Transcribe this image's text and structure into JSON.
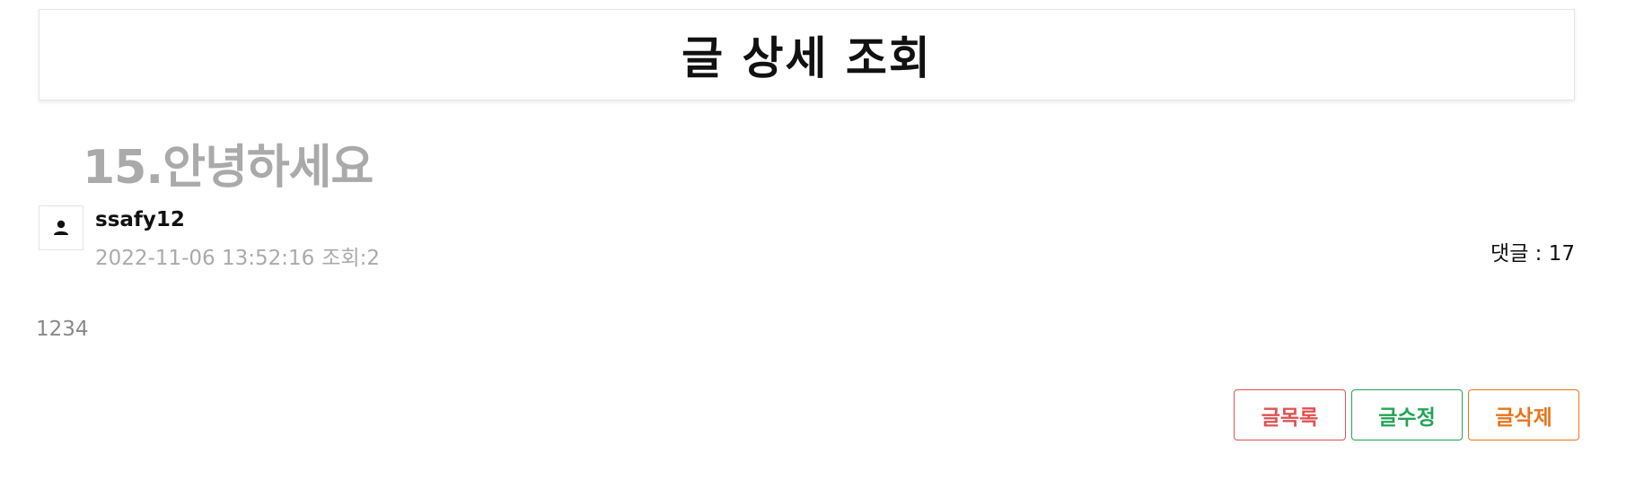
{
  "header": {
    "title": "글 상세 조회"
  },
  "post": {
    "title": "15.안녕하세요",
    "author": "ssafy12",
    "datetime": "2022-11-06 13:52:16",
    "views": "조회:2",
    "comments": "댓글 : 17",
    "content": "1234"
  },
  "actions": {
    "list_label": "글목록",
    "edit_label": "글수정",
    "delete_label": "글삭제"
  },
  "colors": {
    "list": "#e05252",
    "edit": "#23a455",
    "delete": "#e8751a",
    "muted": "#aaaaaa"
  },
  "icons": {
    "avatar": "user-icon"
  }
}
